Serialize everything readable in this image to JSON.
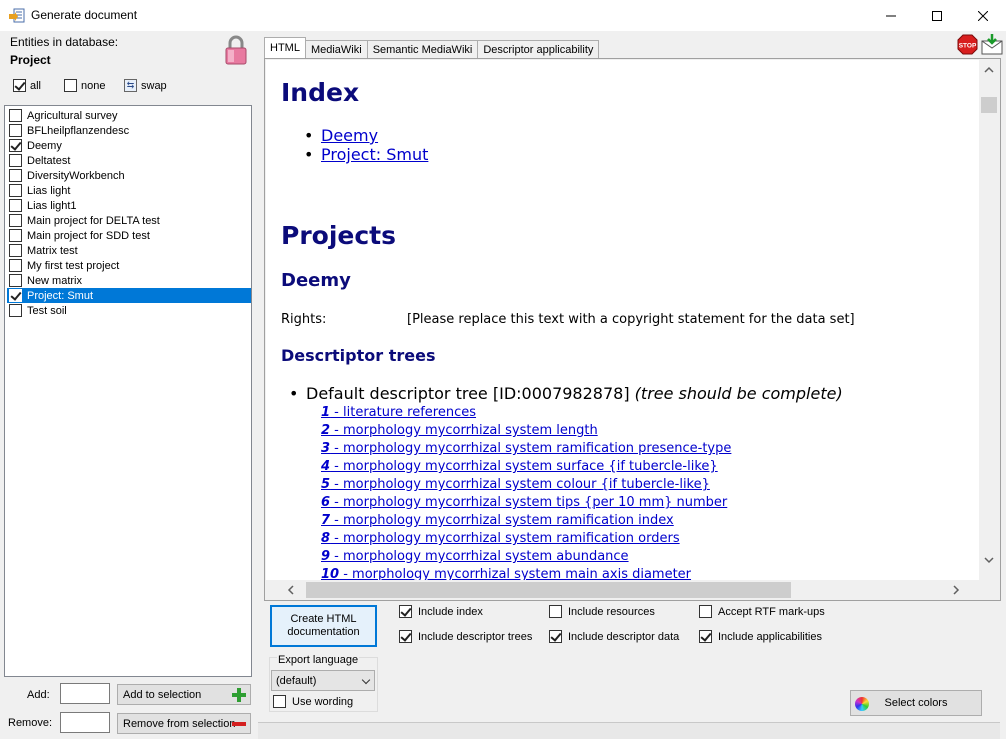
{
  "window": {
    "title": "Generate document"
  },
  "left": {
    "entities_label": "Entities in database:",
    "entities_value": "Project",
    "select_all": "all",
    "select_none": "none",
    "select_swap": "swap",
    "projects": [
      {
        "label": "Agricultural survey",
        "checked": false,
        "selected": false
      },
      {
        "label": "BFLheilpflanzendesc",
        "checked": false,
        "selected": false
      },
      {
        "label": "Deemy",
        "checked": true,
        "selected": false
      },
      {
        "label": "Deltatest",
        "checked": false,
        "selected": false
      },
      {
        "label": "DiversityWorkbench",
        "checked": false,
        "selected": false
      },
      {
        "label": "Lias light",
        "checked": false,
        "selected": false
      },
      {
        "label": "Lias light1",
        "checked": false,
        "selected": false
      },
      {
        "label": "Main project for DELTA test",
        "checked": false,
        "selected": false
      },
      {
        "label": "Main project for SDD test",
        "checked": false,
        "selected": false
      },
      {
        "label": "Matrix test",
        "checked": false,
        "selected": false
      },
      {
        "label": "My first test project",
        "checked": false,
        "selected": false
      },
      {
        "label": "New matrix",
        "checked": false,
        "selected": false
      },
      {
        "label": "Project: Smut",
        "checked": true,
        "selected": true
      },
      {
        "label": "Test soil",
        "checked": false,
        "selected": false
      }
    ],
    "add_label": "Add:",
    "remove_label": "Remove:",
    "add_button": "Add to selection",
    "remove_button": "Remove from selection"
  },
  "tabs": [
    "HTML",
    "MediaWiki",
    "Semantic MediaWiki",
    "Descriptor applicability"
  ],
  "stop_label": "STOP",
  "doc": {
    "index_heading": "Index",
    "index_links": [
      "Deemy",
      "Project: Smut"
    ],
    "projects_heading": "Projects",
    "project_name": "Deemy",
    "rights_key": "Rights:",
    "rights_value": "[Please replace this text with a copyright statement for the data set]",
    "trees_heading": "Descrtiptor trees",
    "tree_title": "Default descriptor tree [ID:0007982878]",
    "tree_note": "(tree should be complete)",
    "descriptors": [
      {
        "num": "1",
        "text": " - literature references"
      },
      {
        "num": "2",
        "text": " - morphology mycorrhizal system length"
      },
      {
        "num": "3",
        "text": " - morphology mycorrhizal system ramification presence-type"
      },
      {
        "num": "4",
        "text": " - morphology mycorrhizal system surface {if tubercle-like}"
      },
      {
        "num": "5",
        "text": " - morphology mycorrhizal system colour {if tubercle-like}"
      },
      {
        "num": "6",
        "text": " - morphology mycorrhizal system tips {per 10 mm} number"
      },
      {
        "num": "7",
        "text": " - morphology mycorrhizal system ramification index"
      },
      {
        "num": "8",
        "text": " - morphology mycorrhizal system ramification orders"
      },
      {
        "num": "9",
        "text": " - morphology mycorrhizal system abundance"
      },
      {
        "num": "10",
        "text": " - morphology mycorrhizal system main axis diameter"
      }
    ]
  },
  "options": {
    "create_button_line1": "Create HTML",
    "create_button_line2": "documentation",
    "include_index": {
      "label": "Include index",
      "checked": true
    },
    "include_resources": {
      "label": "Include resources",
      "checked": false
    },
    "accept_rtf": {
      "label": "Accept RTF mark-ups",
      "checked": false
    },
    "include_trees": {
      "label": "Include descriptor trees",
      "checked": true
    },
    "include_data": {
      "label": "Include descriptor data",
      "checked": true
    },
    "include_applic": {
      "label": "Include applicabilities",
      "checked": true
    },
    "export_language_label": "Export language",
    "export_language_value": "(default)",
    "use_wording": {
      "label": "Use wording",
      "checked": false
    },
    "select_colors": "Select colors"
  }
}
